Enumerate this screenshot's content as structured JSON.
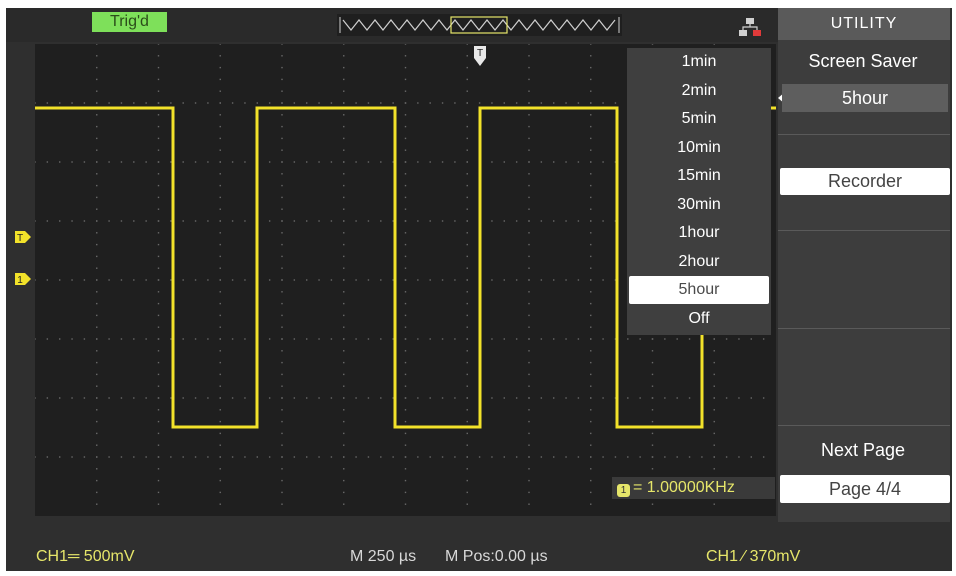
{
  "status": {
    "trigger_badge": "Trig'd"
  },
  "menu": {
    "title": "UTILITY",
    "screen_saver_label": "Screen Saver",
    "screen_saver_value": "5hour",
    "recorder_label": "Recorder",
    "next_page_label": "Next Page",
    "page_indicator": "Page 4/4"
  },
  "dropdown": {
    "options": [
      "1min",
      "2min",
      "5min",
      "10min",
      "15min",
      "30min",
      "1hour",
      "2hour",
      "5hour",
      "Off"
    ],
    "selected": "5hour"
  },
  "measurement": {
    "channel_badge": "1",
    "frequency_text": "= 1.00000KHz"
  },
  "bottom": {
    "ch1_scale": "CH1═ 500mV",
    "timebase": "M 250 µs",
    "position": "M Pos:0.00 µs",
    "trigger": "CH1 ∕ 370mV"
  },
  "markers": {
    "trigger_level": "T",
    "channel_1": "1",
    "trigger_position": "T"
  },
  "colors": {
    "trace": "#f2e22a",
    "trig_badge": "#7ee05a",
    "label_text": "#e6e66a",
    "screen_bg": "#1f1f1f",
    "menu_bg": "#3d3d3d"
  }
}
